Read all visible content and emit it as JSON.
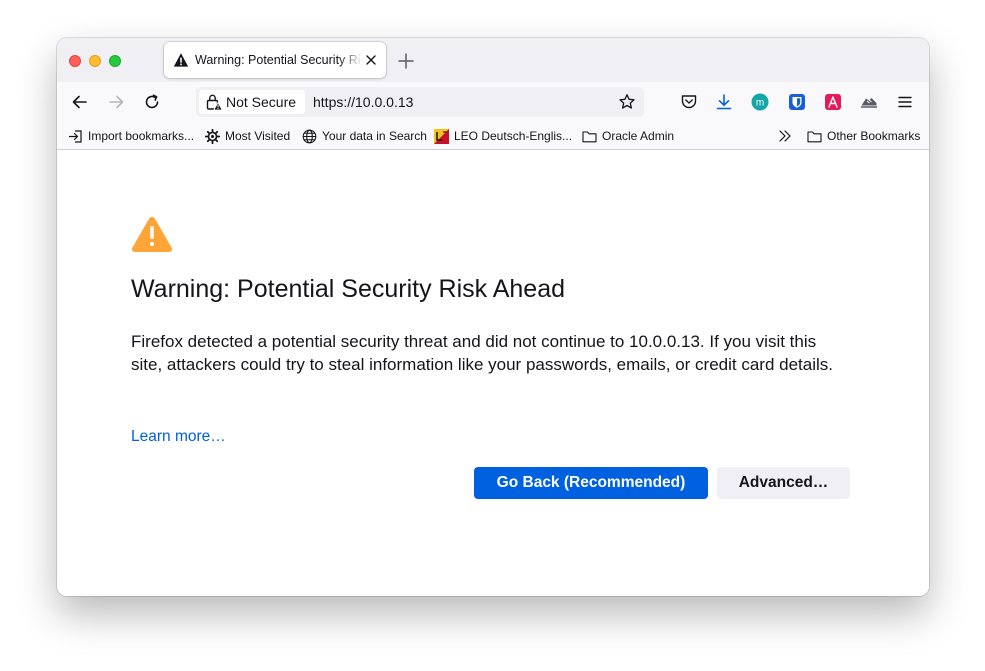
{
  "colors": {
    "accent_blue": "#0061e0",
    "warning_orange": "#ffa436",
    "tabstrip_bg": "#f0f0f4",
    "toolbar_bg": "#f9f9fb"
  },
  "tab": {
    "title": "Warning: Potential Security Risk Ahead",
    "icon": "warning-icon",
    "close_icon": "close-icon"
  },
  "new_tab_icon": "plus-icon",
  "navbar": {
    "back_icon": "arrow-left-icon",
    "forward_icon": "arrow-right-icon",
    "reload_icon": "reload-icon",
    "security_label": "Not Secure",
    "security_icon": "lock-warning-icon",
    "url": "https://10.0.0.13",
    "bookmark_icon": "star-icon",
    "toolbar_icons": [
      "pocket-icon",
      "download-icon",
      "extension-m-icon",
      "bitwarden-icon",
      "adobe-acrobat-icon",
      "extension-shoe-icon",
      "hamburger-menu-icon"
    ]
  },
  "bookmarks": {
    "items": [
      {
        "label": "Import bookmarks...",
        "icon": "import-icon"
      },
      {
        "label": "Most Visited",
        "icon": "gear-icon"
      },
      {
        "label": "Your data in Search",
        "icon": "globe-icon"
      },
      {
        "label": "LEO Deutsch-Englis...",
        "icon": "leo-favicon-icon"
      },
      {
        "label": "Oracle Admin",
        "icon": "folder-icon"
      }
    ],
    "overflow_icon": "double-chevron-icon",
    "other": {
      "label": "Other Bookmarks",
      "icon": "folder-icon"
    }
  },
  "page": {
    "heading": "Warning: Potential Security Risk Ahead",
    "body": "Firefox detected a potential security threat and did not continue to 10.0.0.13. If you visit this site, attackers could try to steal information like your passwords, emails, or credit card details.",
    "learn_more": "Learn more…",
    "go_back": "Go Back (Recommended)",
    "advanced": "Advanced…"
  }
}
